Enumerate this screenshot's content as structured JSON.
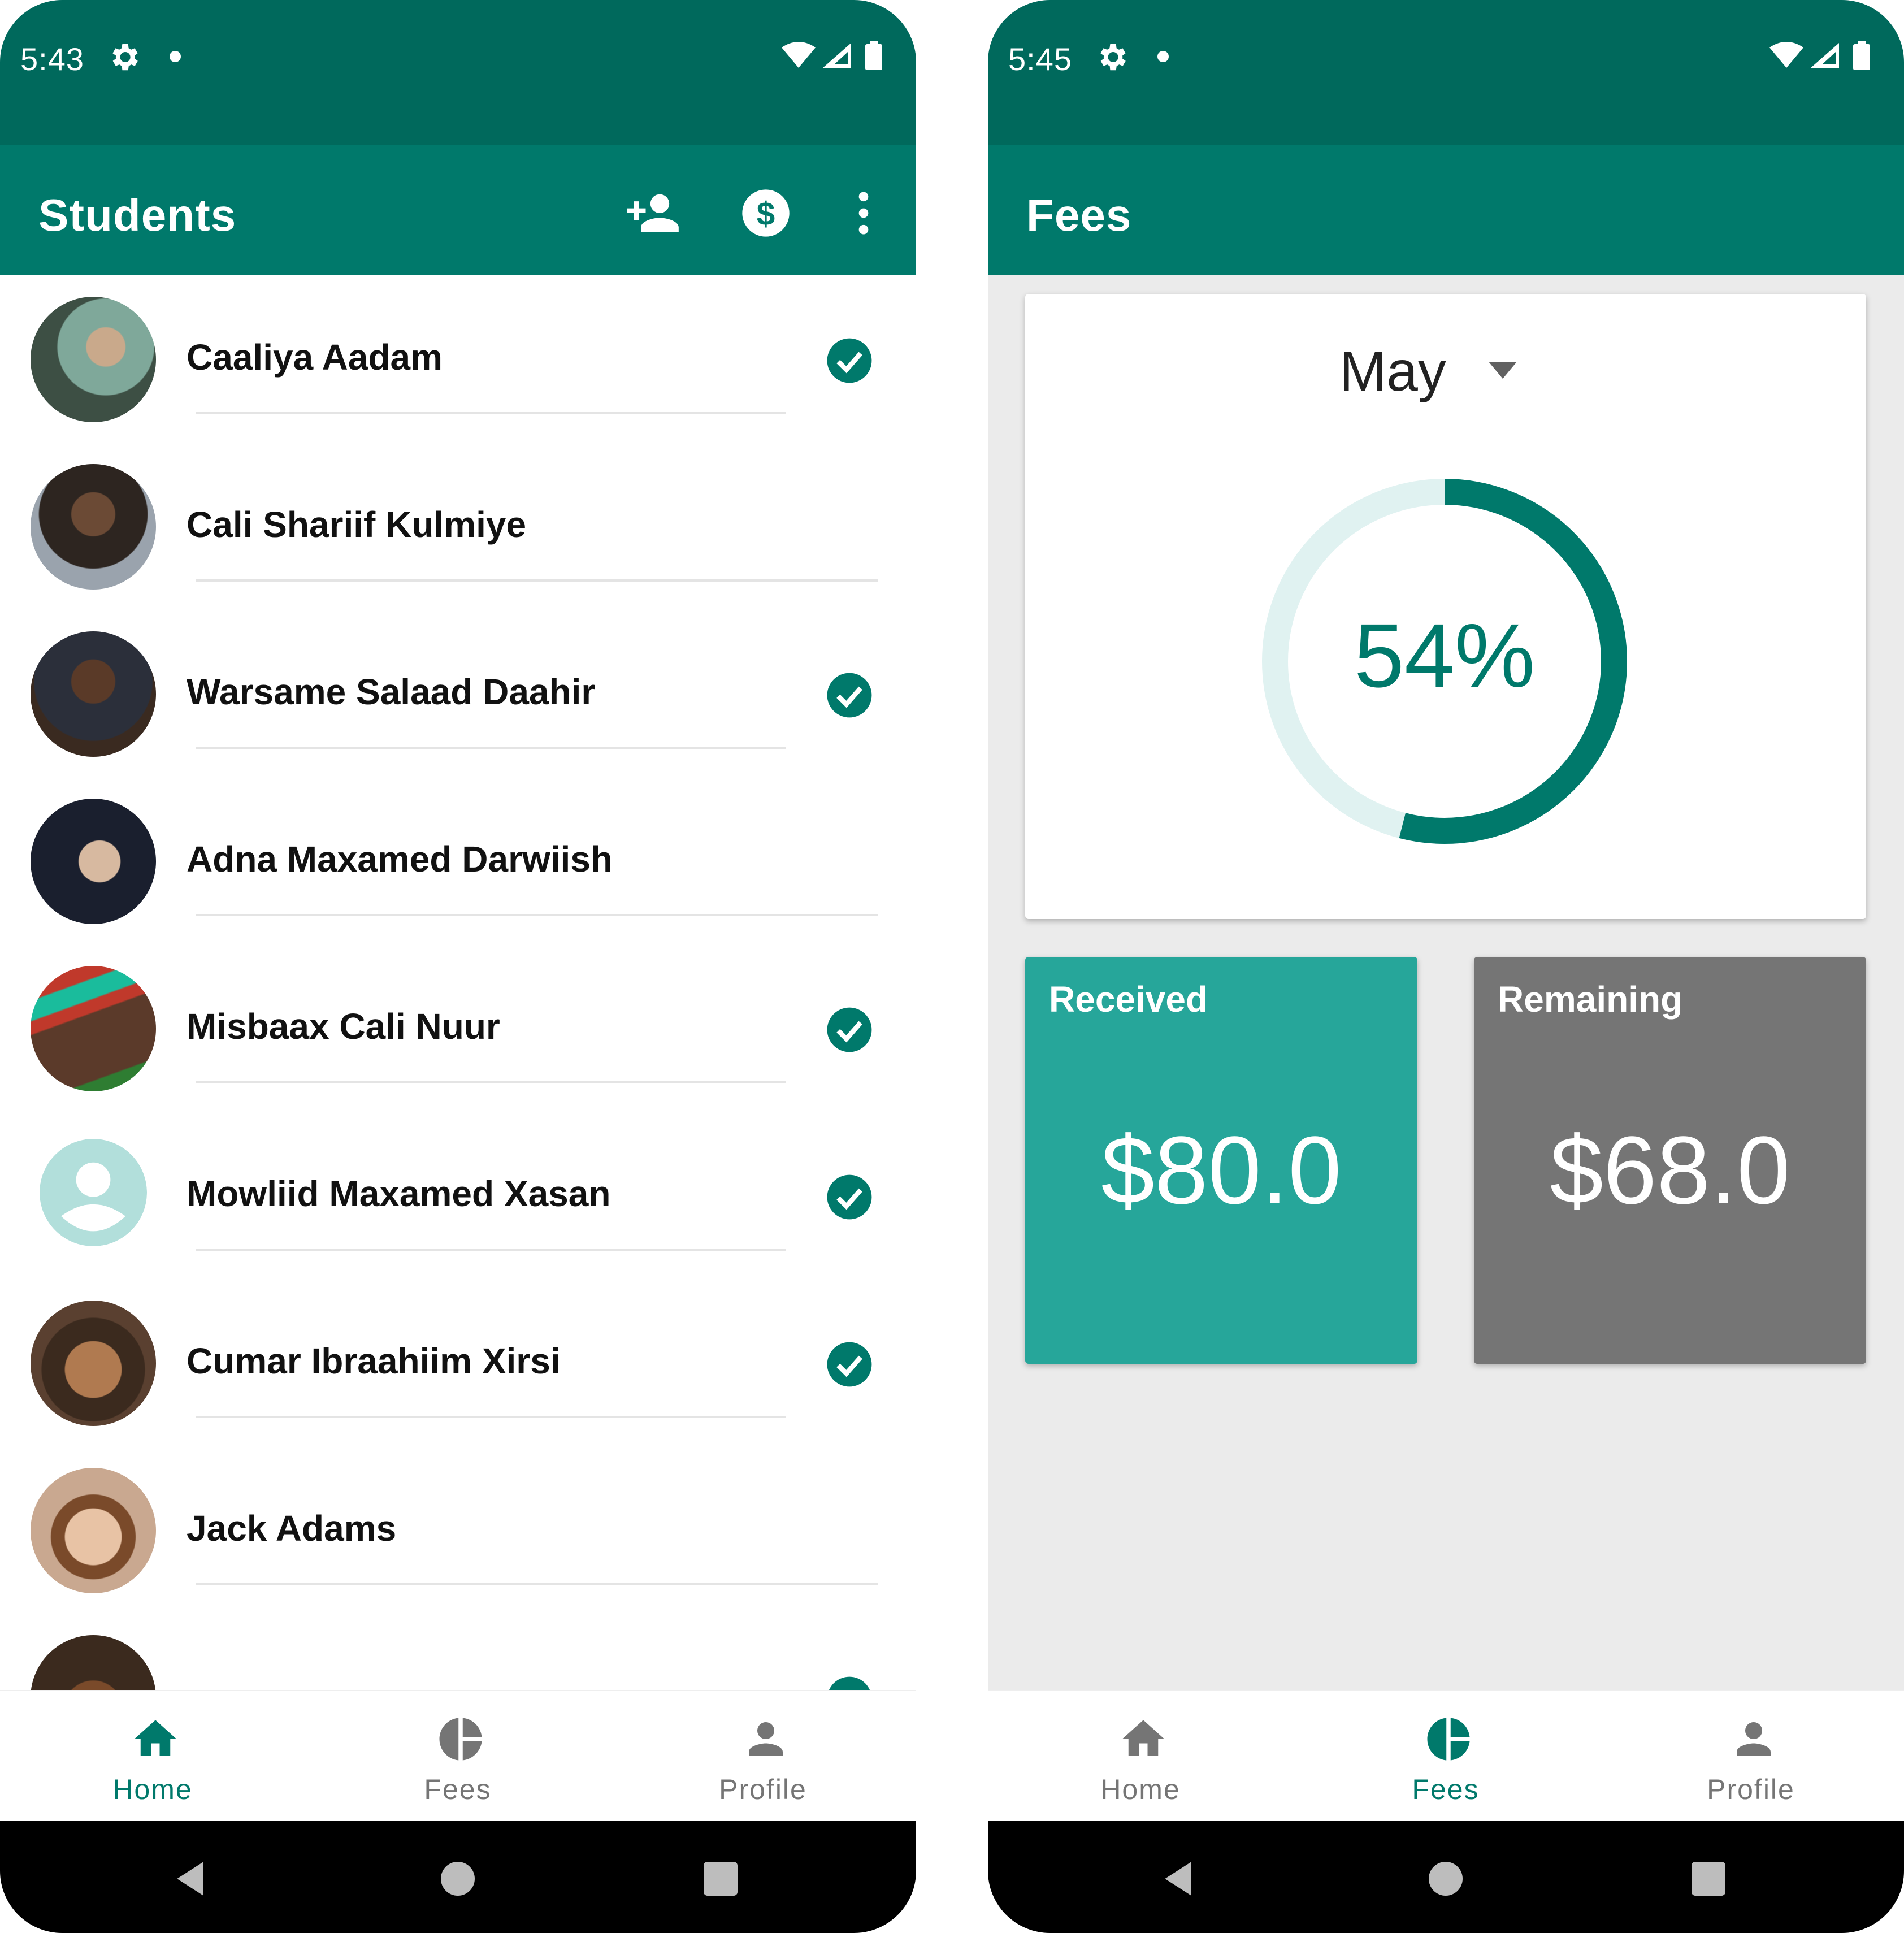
{
  "left_screen": {
    "status": {
      "time": "5:43"
    },
    "appbar": {
      "title": "Students",
      "icons": [
        "person-add-icon",
        "dollar-icon",
        "more-vert-icon"
      ]
    },
    "students": [
      {
        "name": "Caaliya Aadam",
        "paid": true,
        "avatar": "photo-woman-green-hijab"
      },
      {
        "name": "Cali Shariif Kulmiye",
        "paid": false,
        "avatar": "photo-young-man-fence"
      },
      {
        "name": "Warsame Salaad Daahir",
        "paid": true,
        "avatar": "photo-man-thinking"
      },
      {
        "name": "Adna Maxamed Darwiish",
        "paid": false,
        "avatar": "photo-woman-dark-hijab"
      },
      {
        "name": "Misbaax Cali Nuur",
        "paid": true,
        "avatar": "photo-girl-headwrap"
      },
      {
        "name": "Mowliid Maxamed Xasan",
        "paid": true,
        "avatar": "default-person-icon"
      },
      {
        "name": "Cumar Ibraahiim Xirsi",
        "paid": true,
        "avatar": "photo-boy"
      },
      {
        "name": "Jack Adams",
        "paid": false,
        "avatar": "photo-man-glasses"
      },
      {
        "name": "",
        "paid": true,
        "avatar": "photo-partial"
      }
    ],
    "nav": {
      "active": "Home",
      "items": [
        "Home",
        "Fees",
        "Profile"
      ]
    }
  },
  "right_screen": {
    "status": {
      "time": "5:45"
    },
    "appbar": {
      "title": "Fees"
    },
    "month": "May",
    "progress": {
      "percent_label": "54%",
      "fraction": 0.54
    },
    "received": {
      "label": "Received",
      "value": "$80.0"
    },
    "remaining": {
      "label": "Remaining",
      "value": "$68.0"
    },
    "nav": {
      "active": "Fees",
      "items": [
        "Home",
        "Fees",
        "Profile"
      ]
    }
  },
  "colors": {
    "statusbar": "#00695c",
    "appbar": "#00796b",
    "accent": "#00796b",
    "received_card": "#26a69a",
    "remaining_card": "#757575",
    "donut_track": "#e0f2f1",
    "nav_inactive": "#757575"
  }
}
